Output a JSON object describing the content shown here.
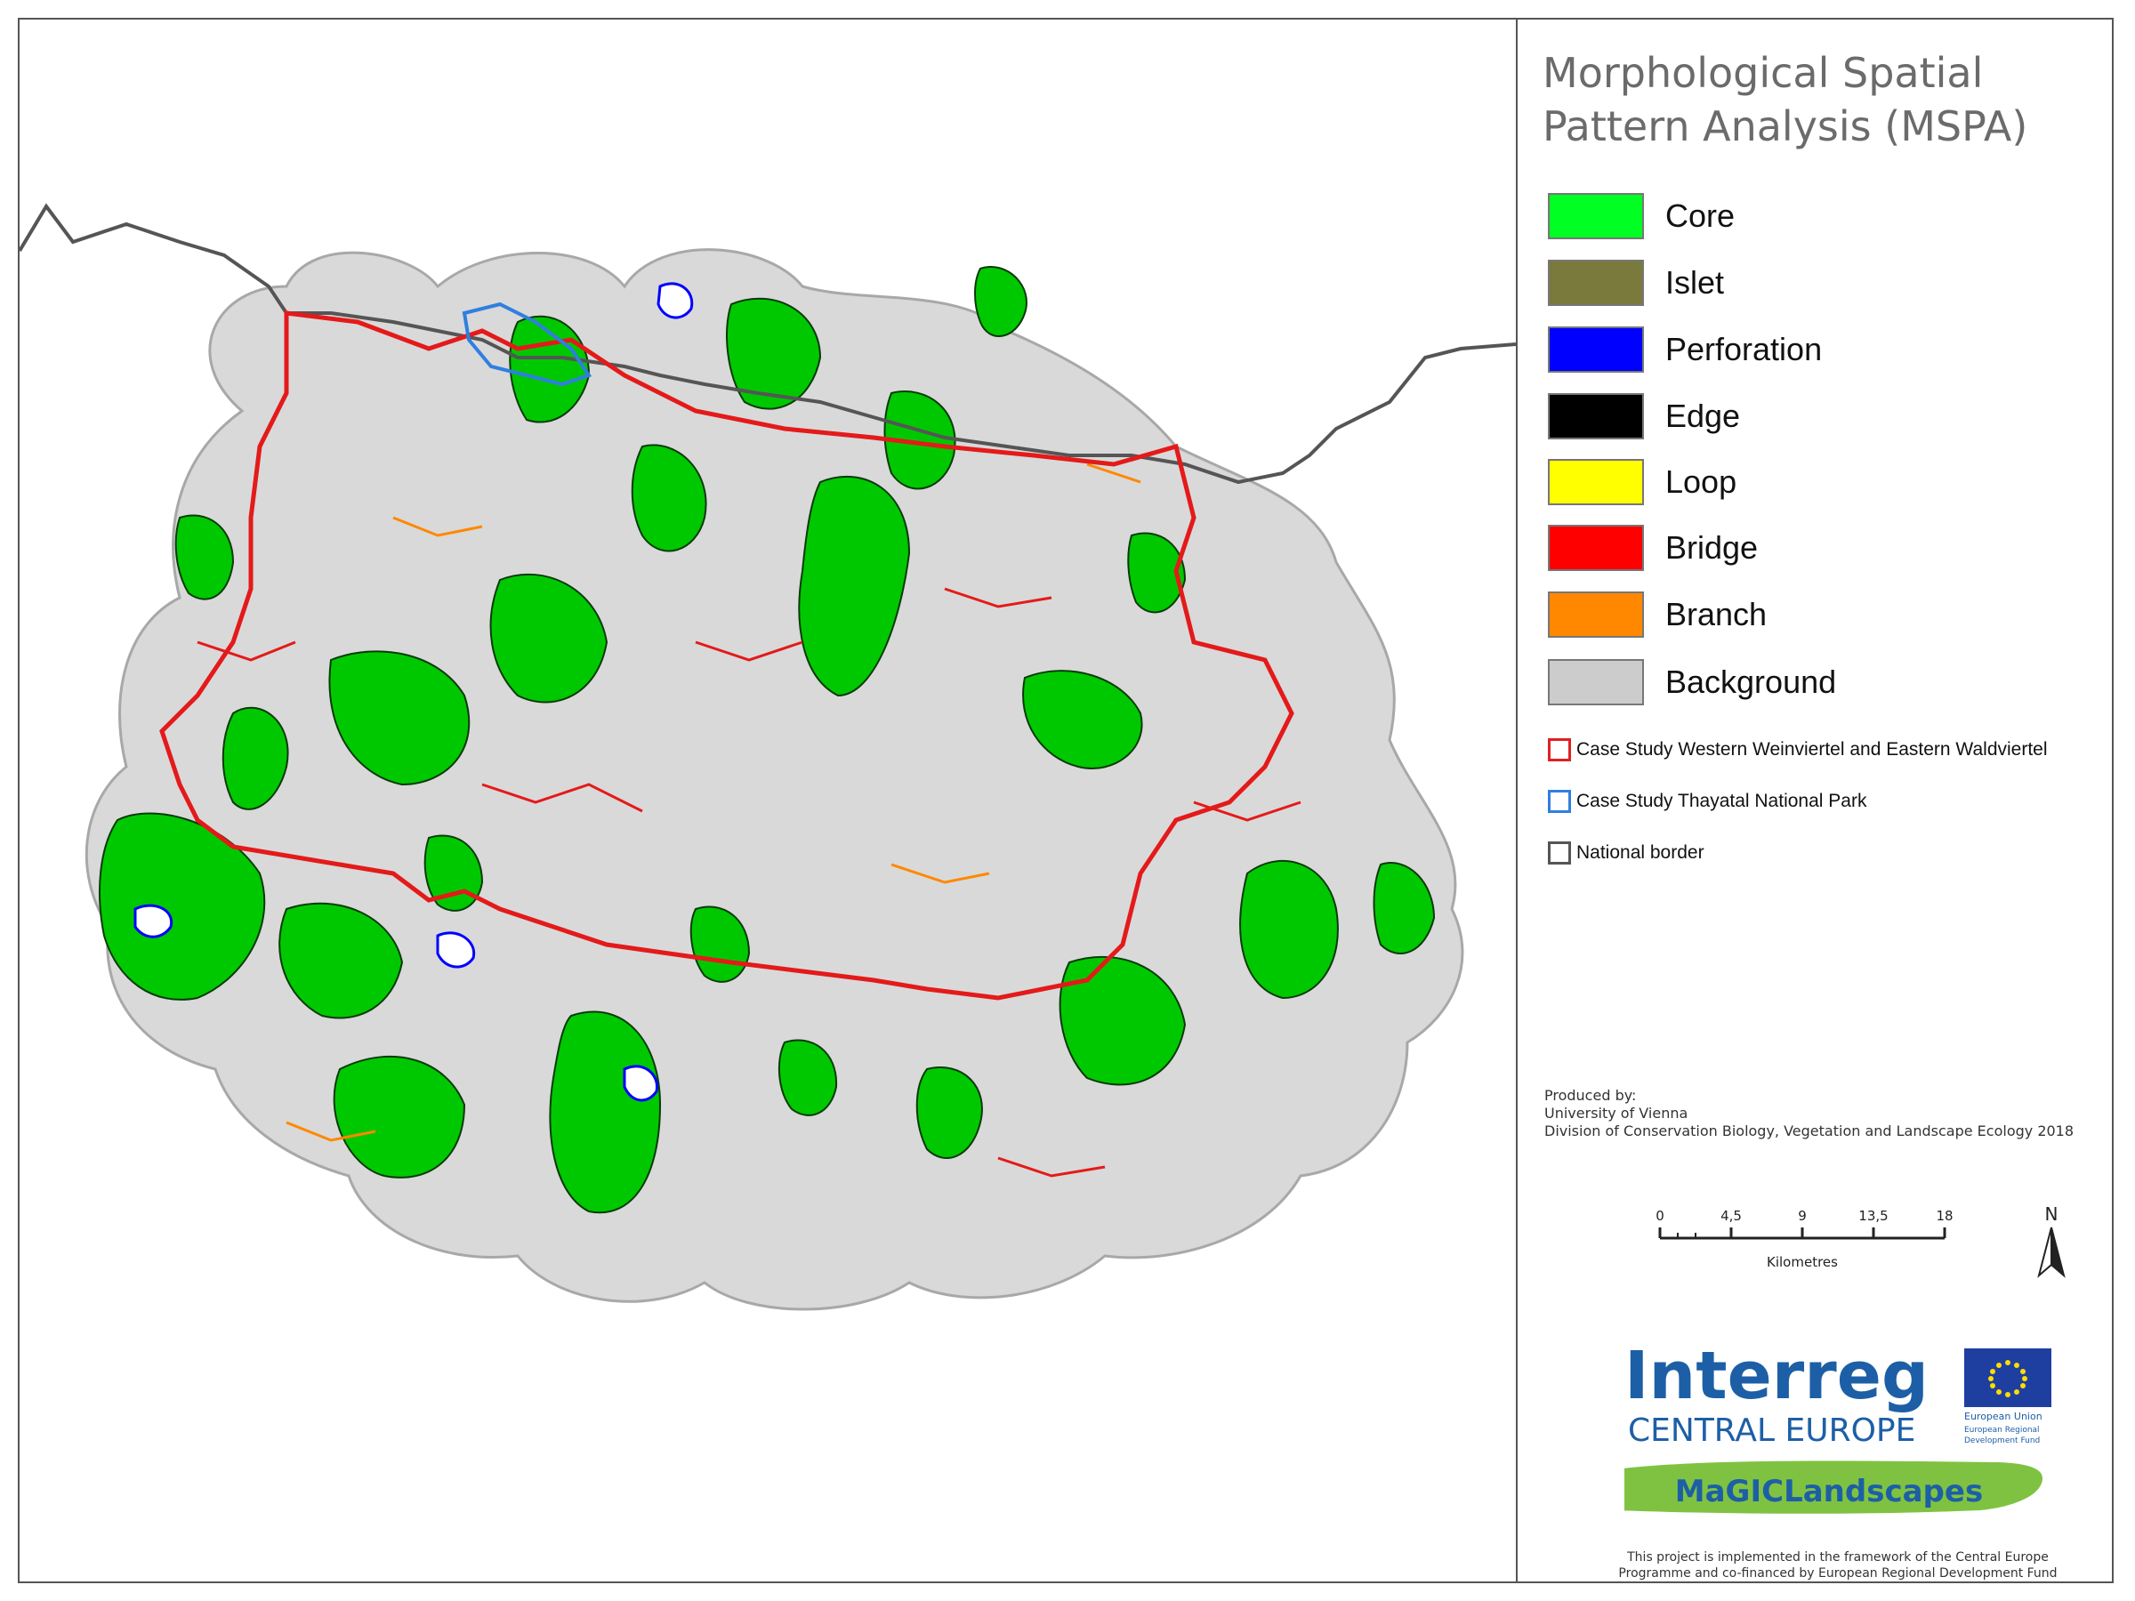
{
  "legend": {
    "title_line1": "Morphological Spatial",
    "title_line2": "Pattern Analysis (MSPA)",
    "classes": [
      {
        "label": "Core",
        "color": "#00ff22"
      },
      {
        "label": "Islet",
        "color": "#7a7a3c"
      },
      {
        "label": "Perforation",
        "color": "#0000ff"
      },
      {
        "label": "Edge",
        "color": "#000000"
      },
      {
        "label": "Loop",
        "color": "#ffff00"
      },
      {
        "label": "Bridge",
        "color": "#ff0000"
      },
      {
        "label": "Branch",
        "color": "#ff8800"
      },
      {
        "label": "Background",
        "color": "#cccccc"
      }
    ],
    "boundaries": [
      {
        "label": "Case Study Western Weinviertel and Eastern Waldviertel",
        "color": "#e02020"
      },
      {
        "label": "Case Study Thayatal National Park",
        "color": "#2f7fe0"
      },
      {
        "label": "National border",
        "color": "#555555"
      }
    ]
  },
  "credits": {
    "produced_by": "Produced by:",
    "institution": "University of Vienna",
    "division": "Division of Conservation Biology, Vegetation and Landscape Ecology 2018"
  },
  "scale": {
    "ticks": [
      "0",
      "4,5",
      "9",
      "13,5",
      "18"
    ],
    "unit": "Kilometres"
  },
  "north_label": "N",
  "logo": {
    "brand": "Interreg",
    "program": "CENTRAL EUROPE",
    "eu_line1": "European Union",
    "eu_line2": "European Regional",
    "eu_line3": "Development Fund",
    "project": "MaGICLandscapes"
  },
  "footnote_line1": "This project is implemented in the framework of the Central Europe",
  "footnote_line2": "Programme and co-financed by European Regional Development Fund",
  "colors": {
    "map_background": "#d9d9d9",
    "core": "#00c800",
    "bridge": "#e41a1a",
    "border": "#555555",
    "thayatal": "#2f7fe0",
    "interreg_blue": "#1d5fa6",
    "eu_blue": "#1f3fa0",
    "magic_green": "#7fc241"
  }
}
